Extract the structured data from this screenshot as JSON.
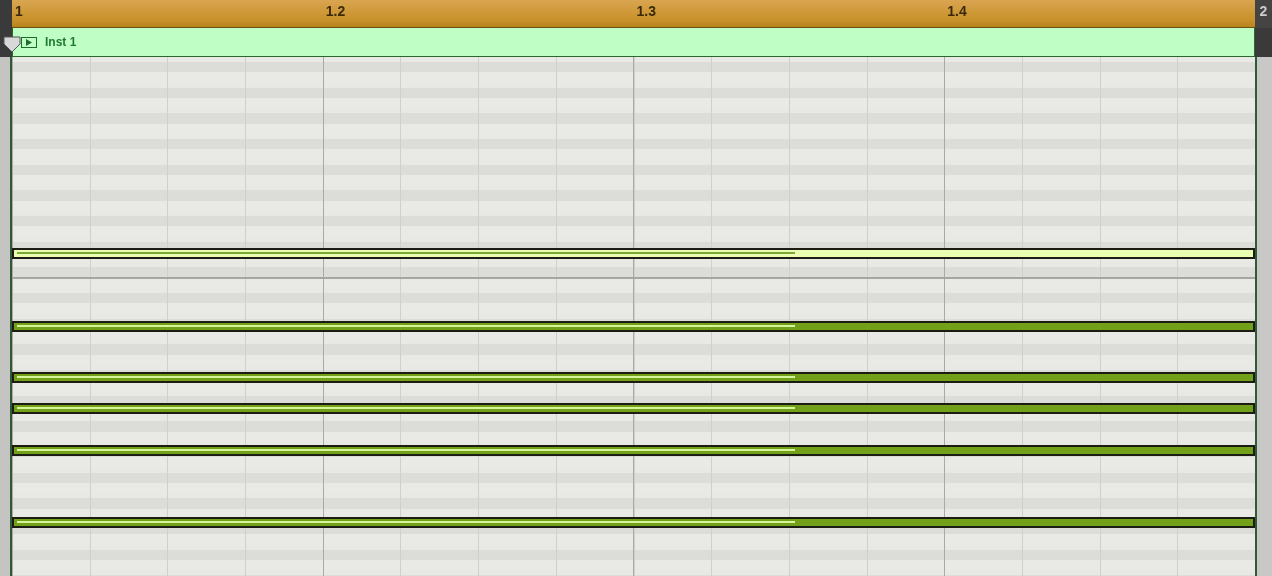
{
  "ruler": {
    "labels": [
      "1",
      "1.2",
      "1.3",
      "1.4"
    ],
    "end_label": "2"
  },
  "region": {
    "name": "Inst 1"
  },
  "notes": [
    {
      "selected": true,
      "level": 0.63
    },
    {
      "selected": false,
      "level": 0.63
    },
    {
      "selected": false,
      "level": 0.63
    },
    {
      "selected": false,
      "level": 0.63
    },
    {
      "selected": false,
      "level": 0.63
    },
    {
      "selected": false,
      "level": 0.63
    }
  ]
}
